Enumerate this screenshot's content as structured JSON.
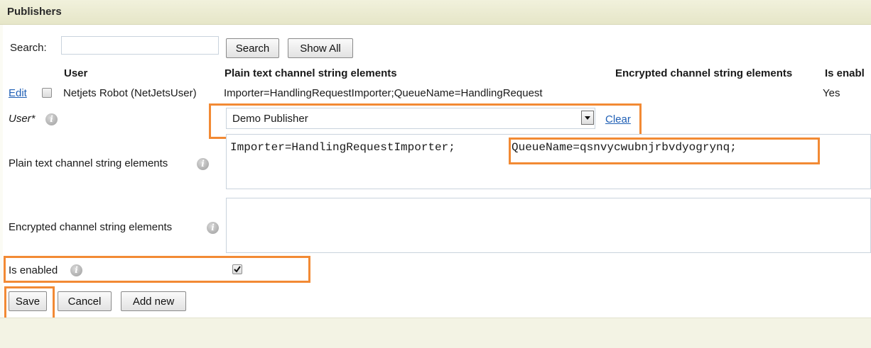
{
  "panel": {
    "title": "Publishers"
  },
  "search": {
    "label": "Search:",
    "value": "",
    "search_button": "Search",
    "show_all_button": "Show All"
  },
  "grid": {
    "columns": [
      "User",
      "Plain text channel string elements",
      "Encrypted channel string elements",
      "Is enabl"
    ],
    "rows": [
      {
        "action": "Edit",
        "selected": false,
        "user": "Netjets Robot (NetJetsUser)",
        "plain": "Importer=HandlingRequestImporter;QueueName=HandlingRequest",
        "encrypted": "",
        "enabled": "Yes"
      }
    ]
  },
  "form": {
    "user_label": "User*",
    "user_value": "Demo Publisher",
    "clear_label": "Clear",
    "plain_label": "Plain text channel string elements",
    "plain_value_part1": "Importer=HandlingRequestImporter;",
    "plain_value_part2": "QueueName=qsnvycwubnjrbvdyogrynq;",
    "encrypted_label": "Encrypted channel string elements",
    "encrypted_value": "",
    "enabled_label": "Is enabled",
    "enabled_checked": true
  },
  "actions": {
    "save": "Save",
    "cancel": "Cancel",
    "add_new": "Add new"
  },
  "colors": {
    "highlight": "#f28a34",
    "link": "#1f5fb5",
    "header_bg": "#ecebd5"
  },
  "icons": [
    "info-icon",
    "dropdown-arrow-icon",
    "checkmark-icon"
  ]
}
